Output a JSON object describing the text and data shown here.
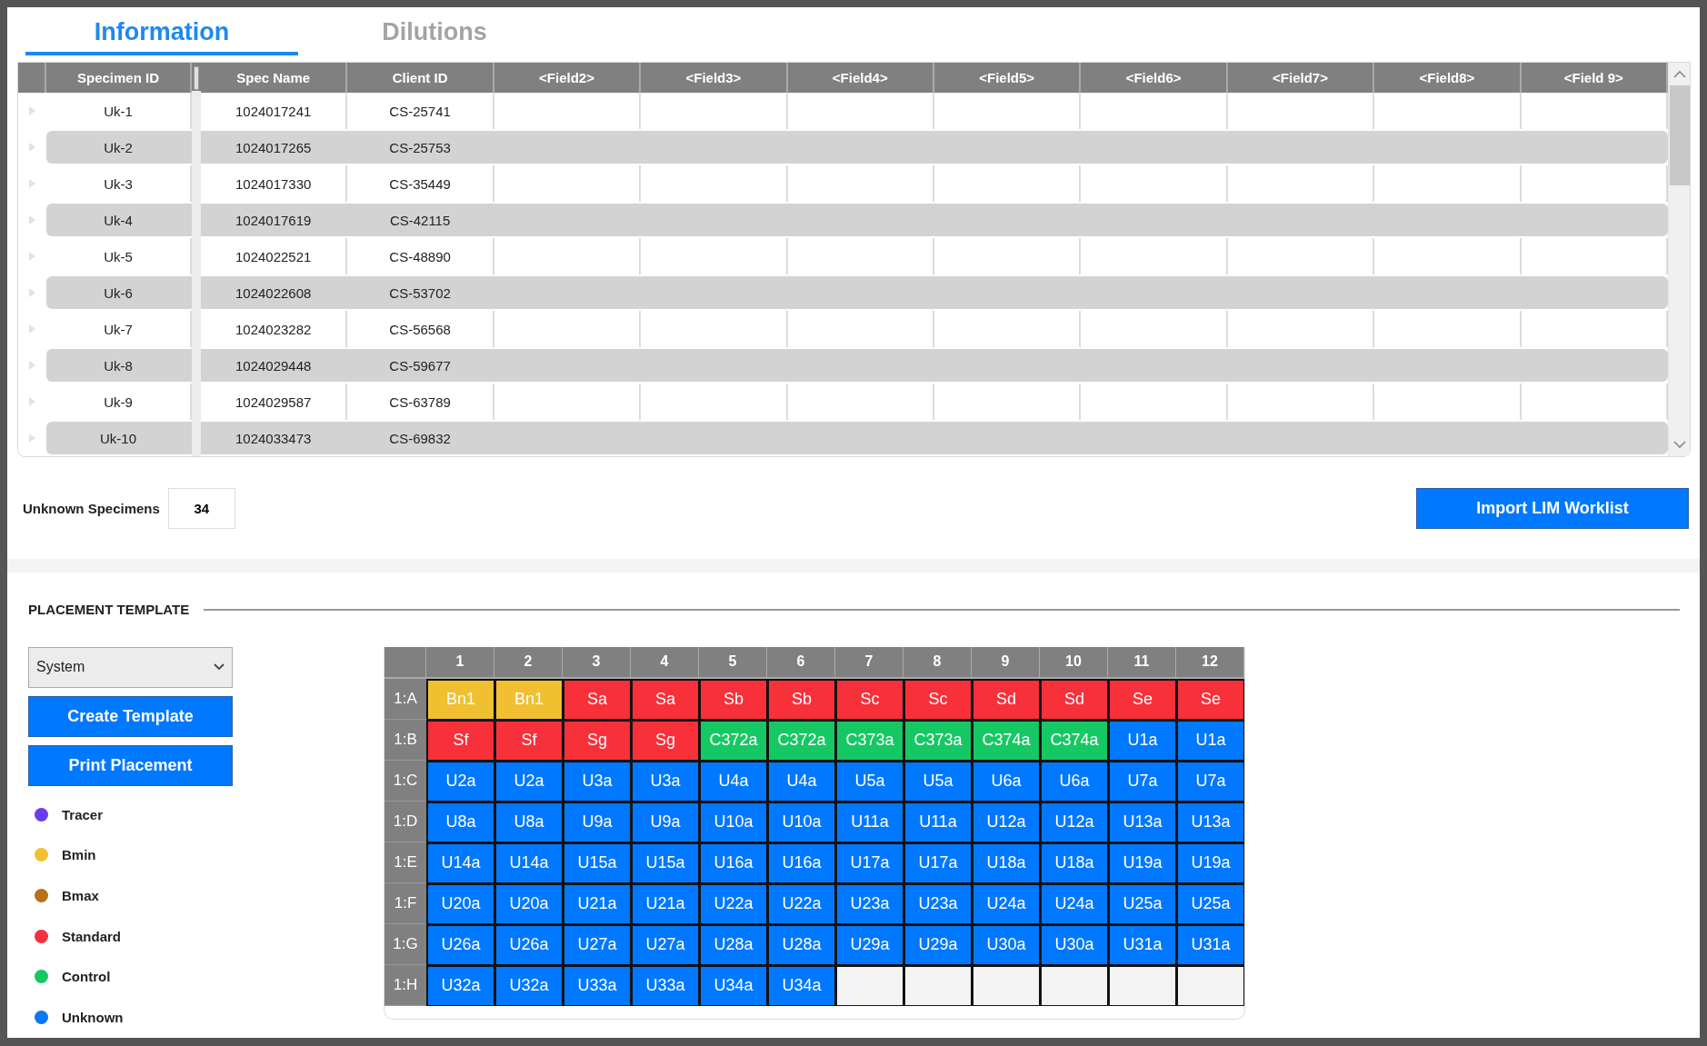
{
  "tabs": [
    {
      "label": "Information",
      "selected": true
    },
    {
      "label": "Dilutions",
      "selected": false
    }
  ],
  "table": {
    "columns": [
      "Specimen ID",
      "Spec Name",
      "Client ID",
      "<Field2>",
      "<Field3>",
      "<Field4>",
      "<Field5>",
      "<Field6>",
      "<Field7>",
      "<Field8>",
      "<Field 9>"
    ],
    "rows": [
      {
        "specimen_id": "Uk-1",
        "spec_name": "1024017241",
        "client_id": "CS-25741"
      },
      {
        "specimen_id": "Uk-2",
        "spec_name": "1024017265",
        "client_id": "CS-25753"
      },
      {
        "specimen_id": "Uk-3",
        "spec_name": "1024017330",
        "client_id": "CS-35449"
      },
      {
        "specimen_id": "Uk-4",
        "spec_name": "1024017619",
        "client_id": "CS-42115"
      },
      {
        "specimen_id": "Uk-5",
        "spec_name": "1024022521",
        "client_id": "CS-48890"
      },
      {
        "specimen_id": "Uk-6",
        "spec_name": "1024022608",
        "client_id": "CS-53702"
      },
      {
        "specimen_id": "Uk-7",
        "spec_name": "1024023282",
        "client_id": "CS-56568"
      },
      {
        "specimen_id": "Uk-8",
        "spec_name": "1024029448",
        "client_id": "CS-59677"
      },
      {
        "specimen_id": "Uk-9",
        "spec_name": "1024029587",
        "client_id": "CS-63789"
      },
      {
        "specimen_id": "Uk-10",
        "spec_name": "1024033473",
        "client_id": "CS-69832"
      }
    ]
  },
  "unknown_specimens": {
    "label": "Unknown Specimens",
    "value": "34"
  },
  "import_button": "Import LIM Worklist",
  "placement_template": {
    "title": "PLACEMENT TEMPLATE",
    "select": {
      "value": "System"
    },
    "buttons": [
      "Create Template",
      "Print Placement"
    ],
    "legend": [
      {
        "label": "Tracer",
        "color": "#6b3cf0"
      },
      {
        "label": "Bmin",
        "color": "#f0c030"
      },
      {
        "label": "Bmax",
        "color": "#b8701e"
      },
      {
        "label": "Standard",
        "color": "#f5303c"
      },
      {
        "label": "Control",
        "color": "#16c864"
      },
      {
        "label": "Unknown",
        "color": "#0a78f0"
      }
    ]
  },
  "plate": {
    "columns": [
      "1",
      "2",
      "3",
      "4",
      "5",
      "6",
      "7",
      "8",
      "9",
      "10",
      "11",
      "12"
    ],
    "rows": [
      {
        "label": "1:A",
        "wells": [
          {
            "text": "Bn1",
            "kind": "bmin"
          },
          {
            "text": "Bn1",
            "kind": "bmin"
          },
          {
            "text": "Sa",
            "kind": "standard"
          },
          {
            "text": "Sa",
            "kind": "standard"
          },
          {
            "text": "Sb",
            "kind": "standard"
          },
          {
            "text": "Sb",
            "kind": "standard"
          },
          {
            "text": "Sc",
            "kind": "standard"
          },
          {
            "text": "Sc",
            "kind": "standard"
          },
          {
            "text": "Sd",
            "kind": "standard"
          },
          {
            "text": "Sd",
            "kind": "standard"
          },
          {
            "text": "Se",
            "kind": "standard"
          },
          {
            "text": "Se",
            "kind": "standard"
          }
        ]
      },
      {
        "label": "1:B",
        "wells": [
          {
            "text": "Sf",
            "kind": "standard"
          },
          {
            "text": "Sf",
            "kind": "standard"
          },
          {
            "text": "Sg",
            "kind": "standard"
          },
          {
            "text": "Sg",
            "kind": "standard"
          },
          {
            "text": "C372a",
            "kind": "control"
          },
          {
            "text": "C372a",
            "kind": "control"
          },
          {
            "text": "C373a",
            "kind": "control"
          },
          {
            "text": "C373a",
            "kind": "control"
          },
          {
            "text": "C374a",
            "kind": "control"
          },
          {
            "text": "C374a",
            "kind": "control"
          },
          {
            "text": "U1a",
            "kind": "unknown"
          },
          {
            "text": "U1a",
            "kind": "unknown"
          }
        ]
      },
      {
        "label": "1:C",
        "wells": [
          {
            "text": "U2a",
            "kind": "unknown"
          },
          {
            "text": "U2a",
            "kind": "unknown"
          },
          {
            "text": "U3a",
            "kind": "unknown"
          },
          {
            "text": "U3a",
            "kind": "unknown"
          },
          {
            "text": "U4a",
            "kind": "unknown"
          },
          {
            "text": "U4a",
            "kind": "unknown"
          },
          {
            "text": "U5a",
            "kind": "unknown"
          },
          {
            "text": "U5a",
            "kind": "unknown"
          },
          {
            "text": "U6a",
            "kind": "unknown"
          },
          {
            "text": "U6a",
            "kind": "unknown"
          },
          {
            "text": "U7a",
            "kind": "unknown"
          },
          {
            "text": "U7a",
            "kind": "unknown"
          }
        ]
      },
      {
        "label": "1:D",
        "wells": [
          {
            "text": "U8a",
            "kind": "unknown"
          },
          {
            "text": "U8a",
            "kind": "unknown"
          },
          {
            "text": "U9a",
            "kind": "unknown"
          },
          {
            "text": "U9a",
            "kind": "unknown"
          },
          {
            "text": "U10a",
            "kind": "unknown"
          },
          {
            "text": "U10a",
            "kind": "unknown"
          },
          {
            "text": "U11a",
            "kind": "unknown"
          },
          {
            "text": "U11a",
            "kind": "unknown"
          },
          {
            "text": "U12a",
            "kind": "unknown"
          },
          {
            "text": "U12a",
            "kind": "unknown"
          },
          {
            "text": "U13a",
            "kind": "unknown"
          },
          {
            "text": "U13a",
            "kind": "unknown"
          }
        ]
      },
      {
        "label": "1:E",
        "wells": [
          {
            "text": "U14a",
            "kind": "unknown"
          },
          {
            "text": "U14a",
            "kind": "unknown"
          },
          {
            "text": "U15a",
            "kind": "unknown"
          },
          {
            "text": "U15a",
            "kind": "unknown"
          },
          {
            "text": "U16a",
            "kind": "unknown"
          },
          {
            "text": "U16a",
            "kind": "unknown"
          },
          {
            "text": "U17a",
            "kind": "unknown"
          },
          {
            "text": "U17a",
            "kind": "unknown"
          },
          {
            "text": "U18a",
            "kind": "unknown"
          },
          {
            "text": "U18a",
            "kind": "unknown"
          },
          {
            "text": "U19a",
            "kind": "unknown"
          },
          {
            "text": "U19a",
            "kind": "unknown"
          }
        ]
      },
      {
        "label": "1:F",
        "wells": [
          {
            "text": "U20a",
            "kind": "unknown"
          },
          {
            "text": "U20a",
            "kind": "unknown"
          },
          {
            "text": "U21a",
            "kind": "unknown"
          },
          {
            "text": "U21a",
            "kind": "unknown"
          },
          {
            "text": "U22a",
            "kind": "unknown"
          },
          {
            "text": "U22a",
            "kind": "unknown"
          },
          {
            "text": "U23a",
            "kind": "unknown"
          },
          {
            "text": "U23a",
            "kind": "unknown"
          },
          {
            "text": "U24a",
            "kind": "unknown"
          },
          {
            "text": "U24a",
            "kind": "unknown"
          },
          {
            "text": "U25a",
            "kind": "unknown"
          },
          {
            "text": "U25a",
            "kind": "unknown"
          }
        ]
      },
      {
        "label": "1:G",
        "wells": [
          {
            "text": "U26a",
            "kind": "unknown"
          },
          {
            "text": "U26a",
            "kind": "unknown"
          },
          {
            "text": "U27a",
            "kind": "unknown"
          },
          {
            "text": "U27a",
            "kind": "unknown"
          },
          {
            "text": "U28a",
            "kind": "unknown"
          },
          {
            "text": "U28a",
            "kind": "unknown"
          },
          {
            "text": "U29a",
            "kind": "unknown"
          },
          {
            "text": "U29a",
            "kind": "unknown"
          },
          {
            "text": "U30a",
            "kind": "unknown"
          },
          {
            "text": "U30a",
            "kind": "unknown"
          },
          {
            "text": "U31a",
            "kind": "unknown"
          },
          {
            "text": "U31a",
            "kind": "unknown"
          }
        ]
      },
      {
        "label": "1:H",
        "wells": [
          {
            "text": "U32a",
            "kind": "unknown"
          },
          {
            "text": "U32a",
            "kind": "unknown"
          },
          {
            "text": "U33a",
            "kind": "unknown"
          },
          {
            "text": "U33a",
            "kind": "unknown"
          },
          {
            "text": "U34a",
            "kind": "unknown"
          },
          {
            "text": "U34a",
            "kind": "unknown"
          },
          {
            "kind": "empty"
          },
          {
            "kind": "empty"
          },
          {
            "kind": "empty"
          },
          {
            "kind": "empty"
          },
          {
            "kind": "empty"
          },
          {
            "kind": "empty"
          }
        ]
      }
    ]
  }
}
